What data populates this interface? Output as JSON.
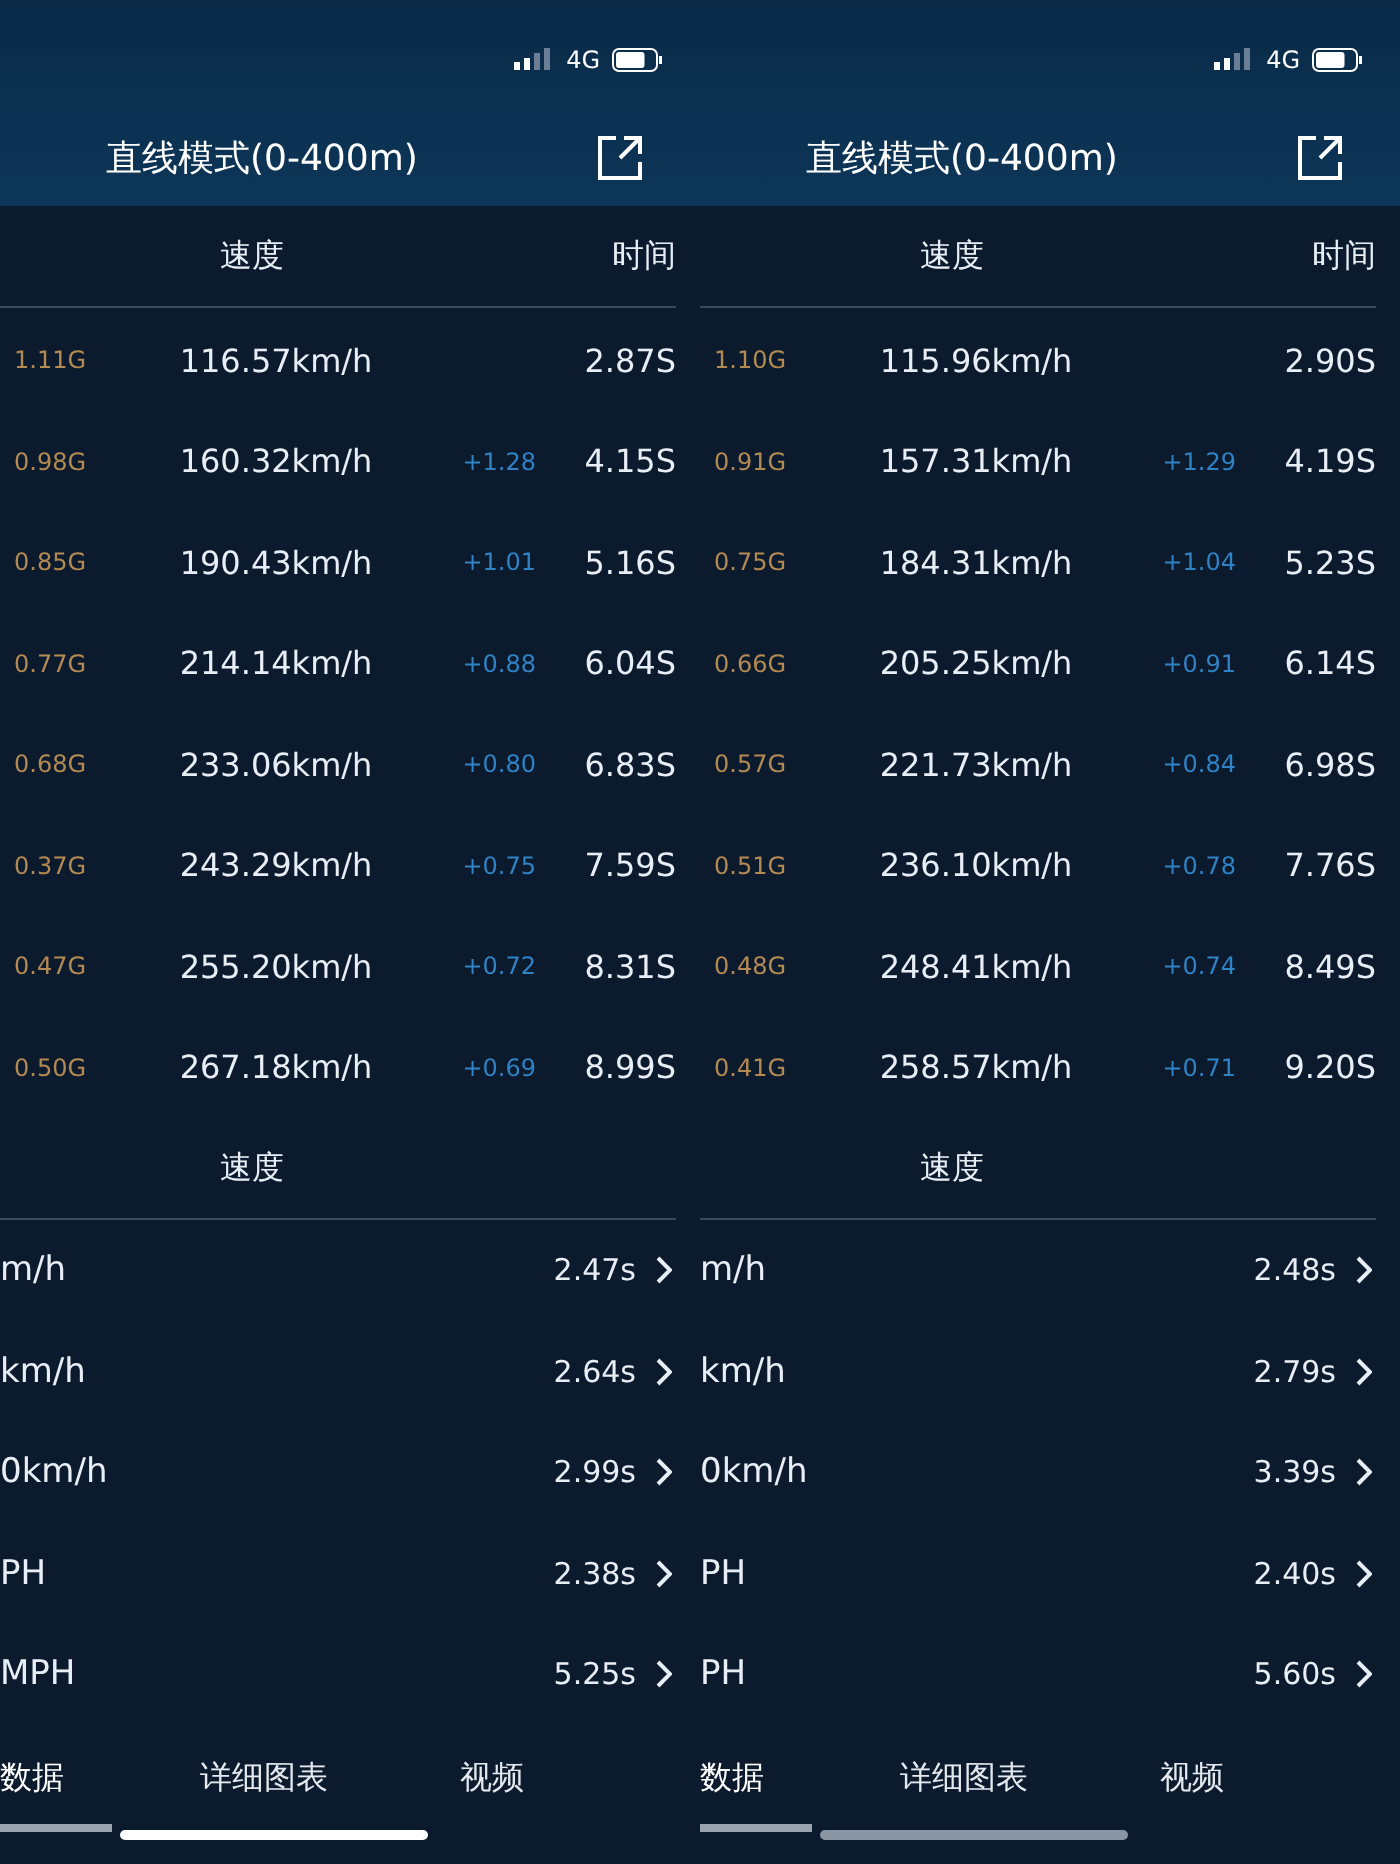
{
  "panels": [
    {
      "status": {
        "network": "4G"
      },
      "title": "直线模式(0-400m)",
      "table_header": {
        "speed": "速度",
        "time": "时间"
      },
      "rows": [
        {
          "g": "1.11G",
          "speed": "116.57km/h",
          "time": "2.87S"
        },
        {
          "g": "0.98G",
          "speed": "160.32km/h",
          "delta": "+1.28",
          "time": "4.15S"
        },
        {
          "g": "0.85G",
          "speed": "190.43km/h",
          "delta": "+1.01",
          "time": "5.16S"
        },
        {
          "g": "0.77G",
          "speed": "214.14km/h",
          "delta": "+0.88",
          "time": "6.04S"
        },
        {
          "g": "0.68G",
          "speed": "233.06km/h",
          "delta": "+0.80",
          "time": "6.83S"
        },
        {
          "g": "0.37G",
          "speed": "243.29km/h",
          "delta": "+0.75",
          "time": "7.59S"
        },
        {
          "g": "0.47G",
          "speed": "255.20km/h",
          "delta": "+0.72",
          "time": "8.31S"
        },
        {
          "g": "0.50G",
          "speed": "267.18km/h",
          "delta": "+0.69",
          "time": "8.99S"
        }
      ],
      "section_label": "速度",
      "splits": [
        {
          "label": "m/h",
          "time": "2.47s"
        },
        {
          "label": "km/h",
          "time": "2.64s"
        },
        {
          "label": "0km/h",
          "time": "2.99s"
        },
        {
          "label": "PH",
          "time": "2.38s"
        },
        {
          "label": "MPH",
          "time": "5.25s"
        }
      ],
      "tabs": [
        {
          "label": "数据",
          "selected": true
        },
        {
          "label": "详细图表",
          "selected": false
        },
        {
          "label": "视频",
          "selected": false
        }
      ]
    },
    {
      "status": {
        "network": "4G"
      },
      "title": "直线模式(0-400m)",
      "table_header": {
        "speed": "速度",
        "time": "时间"
      },
      "rows": [
        {
          "g": "1.10G",
          "speed": "115.96km/h",
          "time": "2.90S"
        },
        {
          "g": "0.91G",
          "speed": "157.31km/h",
          "delta": "+1.29",
          "time": "4.19S"
        },
        {
          "g": "0.75G",
          "speed": "184.31km/h",
          "delta": "+1.04",
          "time": "5.23S"
        },
        {
          "g": "0.66G",
          "speed": "205.25km/h",
          "delta": "+0.91",
          "time": "6.14S"
        },
        {
          "g": "0.57G",
          "speed": "221.73km/h",
          "delta": "+0.84",
          "time": "6.98S"
        },
        {
          "g": "0.51G",
          "speed": "236.10km/h",
          "delta": "+0.78",
          "time": "7.76S"
        },
        {
          "g": "0.48G",
          "speed": "248.41km/h",
          "delta": "+0.74",
          "time": "8.49S"
        },
        {
          "g": "0.41G",
          "speed": "258.57km/h",
          "delta": "+0.71",
          "time": "9.20S"
        }
      ],
      "section_label": "速度",
      "splits": [
        {
          "label": "m/h",
          "time": "2.48s"
        },
        {
          "label": "km/h",
          "time": "2.79s"
        },
        {
          "label": "0km/h",
          "time": "3.39s"
        },
        {
          "label": "PH",
          "time": "2.40s"
        },
        {
          "label": "PH",
          "time": "5.60s"
        }
      ],
      "tabs": [
        {
          "label": "数据",
          "selected": true
        },
        {
          "label": "详细图表",
          "selected": false
        },
        {
          "label": "视频",
          "selected": false
        }
      ]
    }
  ]
}
